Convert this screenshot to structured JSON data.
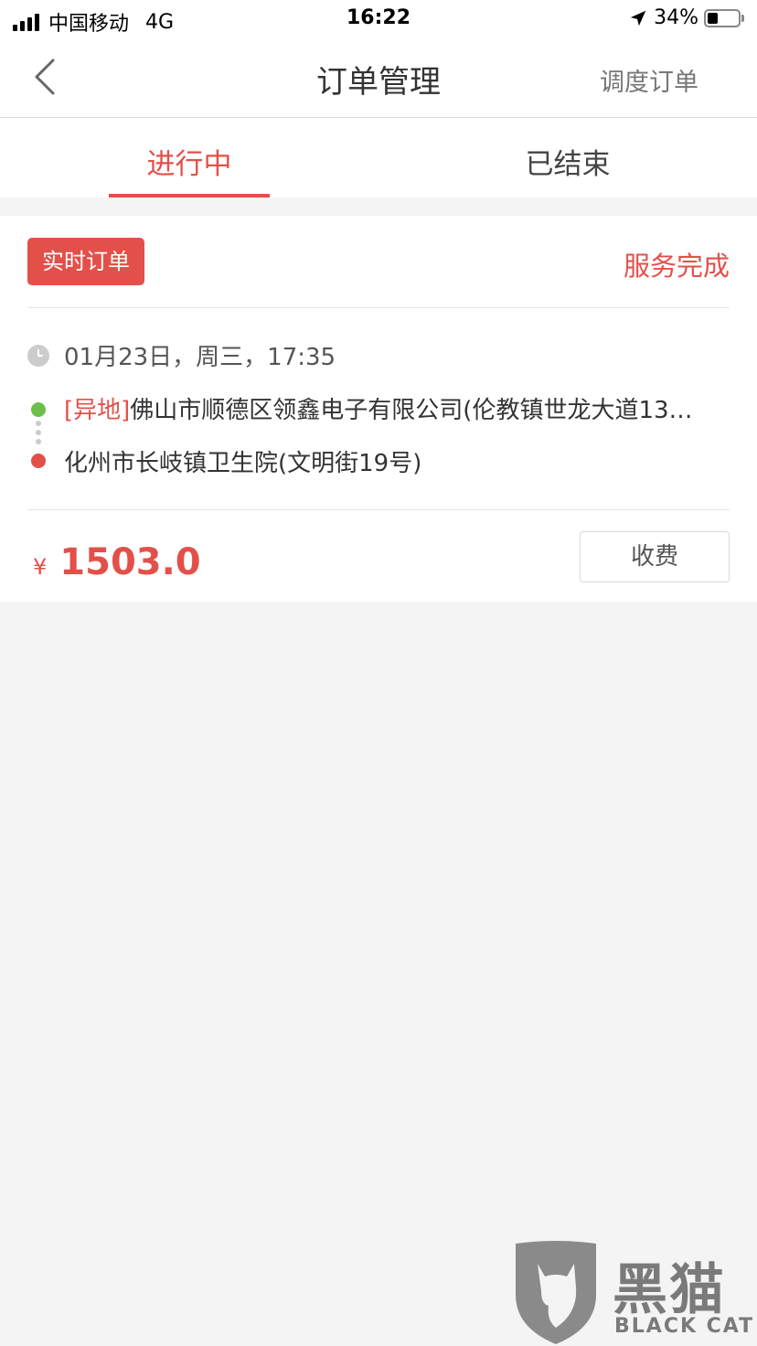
{
  "status_bar": {
    "carrier": "中国移动",
    "network": "4G",
    "time": "16:22",
    "battery": "34%",
    "battery_level": 0.34
  },
  "nav": {
    "title": "订单管理",
    "action_label": "调度订单"
  },
  "tabs": [
    {
      "label": "进行中",
      "active": true
    },
    {
      "label": "已结束",
      "active": false
    }
  ],
  "order": {
    "badge": "实时订单",
    "status": "服务完成",
    "time": "01月23日，周三，17:35",
    "start_tag": "[异地]",
    "start_address": "佛山市顺德区领鑫电子有限公司(伦教镇世龙大道13…",
    "end_address": "化州市长岐镇卫生院(文明街19号)",
    "currency": "¥",
    "price": "1503.0",
    "charge_label": "收费"
  },
  "watermark": {
    "title": "黑猫",
    "subtitle": "BLACK CAT"
  },
  "colors": {
    "accent": "#e3504a",
    "start_dot": "#6cc04a",
    "background": "#f4f4f4"
  },
  "icons": [
    "signal-icon",
    "location-arrow-icon",
    "battery-icon",
    "back-chevron-icon",
    "clock-icon",
    "cat-shield-icon"
  ]
}
